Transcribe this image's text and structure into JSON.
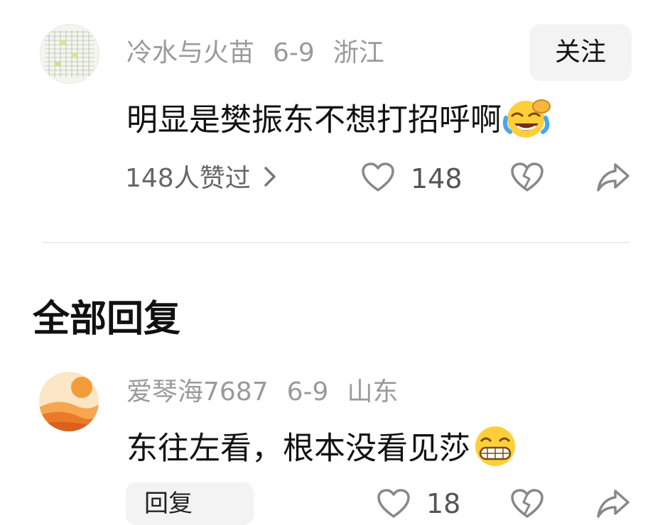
{
  "comment": {
    "username": "冷水与火苗",
    "date": "6-9",
    "location": "浙江",
    "follow_label": "关注",
    "text": "明显是樊振东不想打招呼啊",
    "emoji": "laughing-crying-emoji",
    "likes_summary": "148人赞过",
    "like_count": "148"
  },
  "section": {
    "title": "全部回复"
  },
  "reply": {
    "username": "爱琴海7687",
    "date": "6-9",
    "location": "山东",
    "text": "东往左看，根本没看见莎",
    "emoji": "grinning-emoji",
    "reply_label": "回复",
    "like_count": "18"
  },
  "colors": {
    "meta_gray": "#9a9a9a",
    "button_bg": "#f3f3f3",
    "icon_gray": "#888888"
  }
}
